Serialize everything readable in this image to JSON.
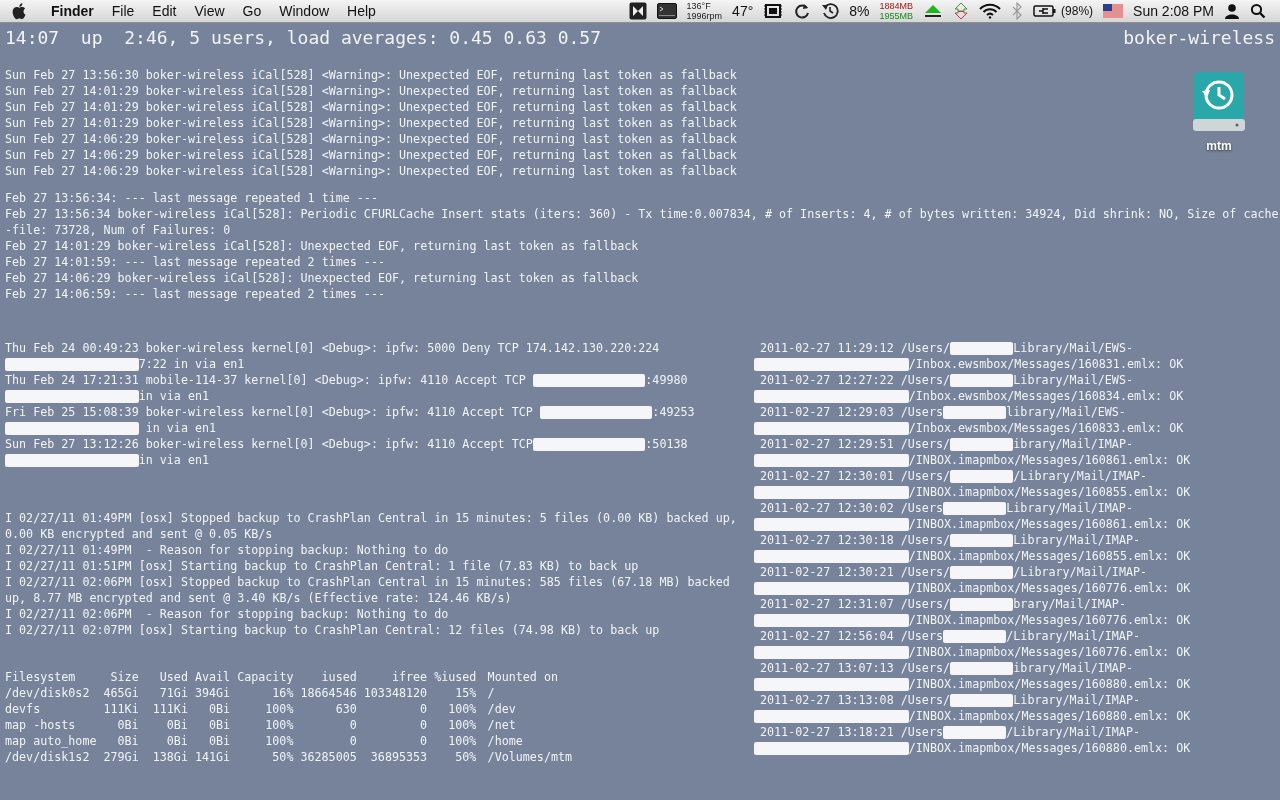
{
  "menubar": {
    "app": "Finder",
    "menus": [
      "File",
      "Edit",
      "View",
      "Go",
      "Window",
      "Help"
    ],
    "status": {
      "temperature": "136°F",
      "fan_speed": "1996rpm",
      "weather": "47°",
      "cpu": "8%",
      "memory_used": "1884MB",
      "memory_free": "1955MB",
      "battery": "(98%)",
      "clock": "Sun 2:08 PM"
    }
  },
  "uptime": "14:07  up  2:46, 5 users, load averages: 0.45 0.63 0.57",
  "hostname": "boker-wireless",
  "desktop_icons": [
    {
      "label": "mtm"
    }
  ],
  "warnings": [
    "Sun Feb 27 13:56:30 boker-wireless iCal[528] <Warning>: Unexpected EOF, returning last token as fallback",
    "Sun Feb 27 14:01:29 boker-wireless iCal[528] <Warning>: Unexpected EOF, returning last token as fallback",
    "Sun Feb 27 14:01:29 boker-wireless iCal[528] <Warning>: Unexpected EOF, returning last token as fallback",
    "Sun Feb 27 14:01:29 boker-wireless iCal[528] <Warning>: Unexpected EOF, returning last token as fallback",
    "Sun Feb 27 14:06:29 boker-wireless iCal[528] <Warning>: Unexpected EOF, returning last token as fallback",
    "Sun Feb 27 14:06:29 boker-wireless iCal[528] <Warning>: Unexpected EOF, returning last token as fallback",
    "Sun Feb 27 14:06:29 boker-wireless iCal[528] <Warning>: Unexpected EOF, returning last token as fallback"
  ],
  "ical_log": [
    "Feb 27 13:56:34: --- last message repeated 1 time ---",
    "Feb 27 13:56:34 boker-wireless iCal[528]: Periodic CFURLCache Insert stats (iters: 360) - Tx time:0.007834, # of Inserts: 4, # of bytes written: 34924, Did shrink: NO, Size of cache",
    "-file: 73728, Num of Failures: 0",
    "Feb 27 14:01:29 boker-wireless iCal[528]: Unexpected EOF, returning last token as fallback",
    "Feb 27 14:01:59: --- last message repeated 2 times ---",
    "Feb 27 14:06:29 boker-wireless iCal[528]: Unexpected EOF, returning last token as fallback",
    "Feb 27 14:06:59: --- last message repeated 2 times ---"
  ],
  "kernel_log": [
    {
      "parts": [
        {
          "kind": "text",
          "text": "Thu Feb 24 00:49:23 boker-wireless kernel[0] <Debug>: ipfw: 5000 Deny TCP 174.142.130.220:224"
        }
      ]
    },
    {
      "parts": [
        {
          "kind": "redacted"
        },
        {
          "kind": "text",
          "text": "7:22 in via en1"
        }
      ]
    },
    {
      "parts": [
        {
          "kind": "text",
          "text": "Thu Feb 24 17:21:31 mobile-114-37 kernel[0] <Debug>: ipfw: 4110 Accept TCP "
        },
        {
          "kind": "redacted"
        },
        {
          "kind": "text",
          "text": ":49980"
        }
      ]
    },
    {
      "parts": [
        {
          "kind": "redacted"
        },
        {
          "kind": "text",
          "text": "in via en1"
        }
      ]
    },
    {
      "parts": [
        {
          "kind": "text",
          "text": "Fri Feb 25 15:08:39 boker-wireless kernel[0] <Debug>: ipfw: 4110 Accept TCP "
        },
        {
          "kind": "redacted"
        },
        {
          "kind": "text",
          "text": ":49253"
        }
      ]
    },
    {
      "parts": [
        {
          "kind": "redacted"
        },
        {
          "kind": "text",
          "text": " in via en1"
        }
      ]
    },
    {
      "parts": [
        {
          "kind": "text",
          "text": "Sun Feb 27 13:12:26 boker-wireless kernel[0] <Debug>: ipfw: 4110 Accept TCP"
        },
        {
          "kind": "redacted"
        },
        {
          "kind": "text",
          "text": ":50138"
        }
      ]
    },
    {
      "parts": [
        {
          "kind": "redacted"
        },
        {
          "kind": "text",
          "text": "in via en1"
        }
      ]
    }
  ],
  "backup_log": [
    "I 02/27/11 01:49PM [osx] Stopped backup to CrashPlan Central in 15 minutes: 5 files (0.00 KB) backed up,",
    "0.00 KB encrypted and sent @ 0.05 KB/s",
    "I 02/27/11 01:49PM  - Reason for stopping backup: Nothing to do",
    "I 02/27/11 01:51PM [osx] Starting backup to CrashPlan Central: 1 file (7.83 KB) to back up",
    "I 02/27/11 02:06PM [osx] Stopped backup to CrashPlan Central in 15 minutes: 585 files (67.18 MB) backed",
    "up, 8.77 MB encrypted and sent @ 3.40 KB/s (Effective rate: 124.46 KB/s)",
    "I 02/27/11 02:06PM  - Reason for stopping backup: Nothing to do",
    "I 02/27/11 02:07PM [osx] Starting backup to CrashPlan Central: 12 files (74.98 KB) to back up"
  ],
  "disk_usage": {
    "columns": [
      "Filesystem",
      "Size",
      "Used",
      "Avail",
      "Capacity",
      "iused",
      "ifree",
      "%iused",
      "Mounted on"
    ],
    "rows": [
      [
        "/dev/disk0s2",
        "465Gi",
        "71Gi",
        "394Gi",
        "16%",
        "18664546",
        "103348120",
        "15%",
        "/"
      ],
      [
        "devfs",
        "111Ki",
        "111Ki",
        "0Bi",
        "100%",
        "630",
        "0",
        "100%",
        "/dev"
      ],
      [
        "map -hosts",
        "0Bi",
        "0Bi",
        "0Bi",
        "100%",
        "0",
        "0",
        "100%",
        "/net"
      ],
      [
        "map auto_home",
        "0Bi",
        "0Bi",
        "0Bi",
        "100%",
        "0",
        "0",
        "100%",
        "/home"
      ],
      [
        "/dev/disk1s2",
        "279Gi",
        "138Gi",
        "141Gi",
        "50%",
        "36285005",
        "36895353",
        "50%",
        "/Volumes/mtm"
      ]
    ]
  },
  "mail_log": [
    {
      "parts": [
        {
          "kind": "text",
          "text": "2011-02-27 11:29:12 /Users/"
        },
        {
          "kind": "redacted"
        },
        {
          "kind": "text",
          "text": "Library/Mail/EWS-"
        }
      ]
    },
    {
      "parts": [
        {
          "kind": "redacted"
        },
        {
          "kind": "text",
          "text": "/Inbox.ewsmbox/Messages/160831.emlx: OK"
        }
      ]
    },
    {
      "parts": [
        {
          "kind": "text",
          "text": "2011-02-27 12:27:22 /Users/"
        },
        {
          "kind": "redacted"
        },
        {
          "kind": "text",
          "text": "Library/Mail/EWS-"
        }
      ]
    },
    {
      "parts": [
        {
          "kind": "redacted"
        },
        {
          "kind": "text",
          "text": "/Inbox.ewsmbox/Messages/160834.emlx: OK"
        }
      ]
    },
    {
      "parts": [
        {
          "kind": "text",
          "text": "2011-02-27 12:29:03 /Users"
        },
        {
          "kind": "redacted"
        },
        {
          "kind": "text",
          "text": "library/Mail/EWS-"
        }
      ]
    },
    {
      "parts": [
        {
          "kind": "redacted"
        },
        {
          "kind": "text",
          "text": "/Inbox.ewsmbox/Messages/160833.emlx: OK"
        }
      ]
    },
    {
      "parts": [
        {
          "kind": "text",
          "text": "2011-02-27 12:29:51 /Users/"
        },
        {
          "kind": "redacted"
        },
        {
          "kind": "text",
          "text": "ibrary/Mail/IMAP-"
        }
      ]
    },
    {
      "parts": [
        {
          "kind": "redacted"
        },
        {
          "kind": "text",
          "text": "/INBOX.imapmbox/Messages/160861.emlx: OK"
        }
      ]
    },
    {
      "parts": [
        {
          "kind": "text",
          "text": "2011-02-27 12:30:01 /Users/"
        },
        {
          "kind": "redacted"
        },
        {
          "kind": "text",
          "text": "/Library/Mail/IMAP-"
        }
      ]
    },
    {
      "parts": [
        {
          "kind": "redacted"
        },
        {
          "kind": "text",
          "text": "/INBOX.imapmbox/Messages/160855.emlx: OK"
        }
      ]
    },
    {
      "parts": [
        {
          "kind": "text",
          "text": "2011-02-27 12:30:02 /Users"
        },
        {
          "kind": "redacted"
        },
        {
          "kind": "text",
          "text": "Library/Mail/IMAP-"
        }
      ]
    },
    {
      "parts": [
        {
          "kind": "redacted"
        },
        {
          "kind": "text",
          "text": "/INBOX.imapmbox/Messages/160861.emlx: OK"
        }
      ]
    },
    {
      "parts": [
        {
          "kind": "text",
          "text": "2011-02-27 12:30:18 /Users/"
        },
        {
          "kind": "redacted"
        },
        {
          "kind": "text",
          "text": "Library/Mail/IMAP-"
        }
      ]
    },
    {
      "parts": [
        {
          "kind": "redacted"
        },
        {
          "kind": "text",
          "text": "/INBOX.imapmbox/Messages/160855.emlx: OK"
        }
      ]
    },
    {
      "parts": [
        {
          "kind": "text",
          "text": "2011-02-27 12:30:21 /Users/"
        },
        {
          "kind": "redacted"
        },
        {
          "kind": "text",
          "text": "/Library/Mail/IMAP-"
        }
      ]
    },
    {
      "parts": [
        {
          "kind": "redacted"
        },
        {
          "kind": "text",
          "text": "/INBOX.imapmbox/Messages/160776.emlx: OK"
        }
      ]
    },
    {
      "parts": [
        {
          "kind": "text",
          "text": "2011-02-27 12:31:07 /Users/"
        },
        {
          "kind": "redacted"
        },
        {
          "kind": "text",
          "text": "brary/Mail/IMAP-"
        }
      ]
    },
    {
      "parts": [
        {
          "kind": "redacted"
        },
        {
          "kind": "text",
          "text": "/INBOX.imapmbox/Messages/160776.emlx: OK"
        }
      ]
    },
    {
      "parts": [
        {
          "kind": "text",
          "text": "2011-02-27 12:56:04 /Users"
        },
        {
          "kind": "redacted"
        },
        {
          "kind": "text",
          "text": "/Library/Mail/IMAP-"
        }
      ]
    },
    {
      "parts": [
        {
          "kind": "redacted"
        },
        {
          "kind": "text",
          "text": "/INBOX.imapmbox/Messages/160776.emlx: OK"
        }
      ]
    },
    {
      "parts": [
        {
          "kind": "text",
          "text": "2011-02-27 13:07:13 /Users/"
        },
        {
          "kind": "redacted"
        },
        {
          "kind": "text",
          "text": "ibrary/Mail/IMAP-"
        }
      ]
    },
    {
      "parts": [
        {
          "kind": "redacted"
        },
        {
          "kind": "text",
          "text": "/INBOX.imapmbox/Messages/160880.emlx: OK"
        }
      ]
    },
    {
      "parts": [
        {
          "kind": "text",
          "text": "2011-02-27 13:13:08 /Users/"
        },
        {
          "kind": "redacted"
        },
        {
          "kind": "text",
          "text": "Library/Mail/IMAP-"
        }
      ]
    },
    {
      "parts": [
        {
          "kind": "redacted"
        },
        {
          "kind": "text",
          "text": "/INBOX.imapmbox/Messages/160880.emlx: OK"
        }
      ]
    },
    {
      "parts": [
        {
          "kind": "text",
          "text": "2011-02-27 13:18:21 /Users"
        },
        {
          "kind": "redacted"
        },
        {
          "kind": "text",
          "text": "/Library/Mail/IMAP-"
        }
      ]
    },
    {
      "parts": [
        {
          "kind": "redacted"
        },
        {
          "kind": "text",
          "text": "/INBOX.imapmbox/Messages/160880.emlx: OK"
        }
      ]
    }
  ]
}
